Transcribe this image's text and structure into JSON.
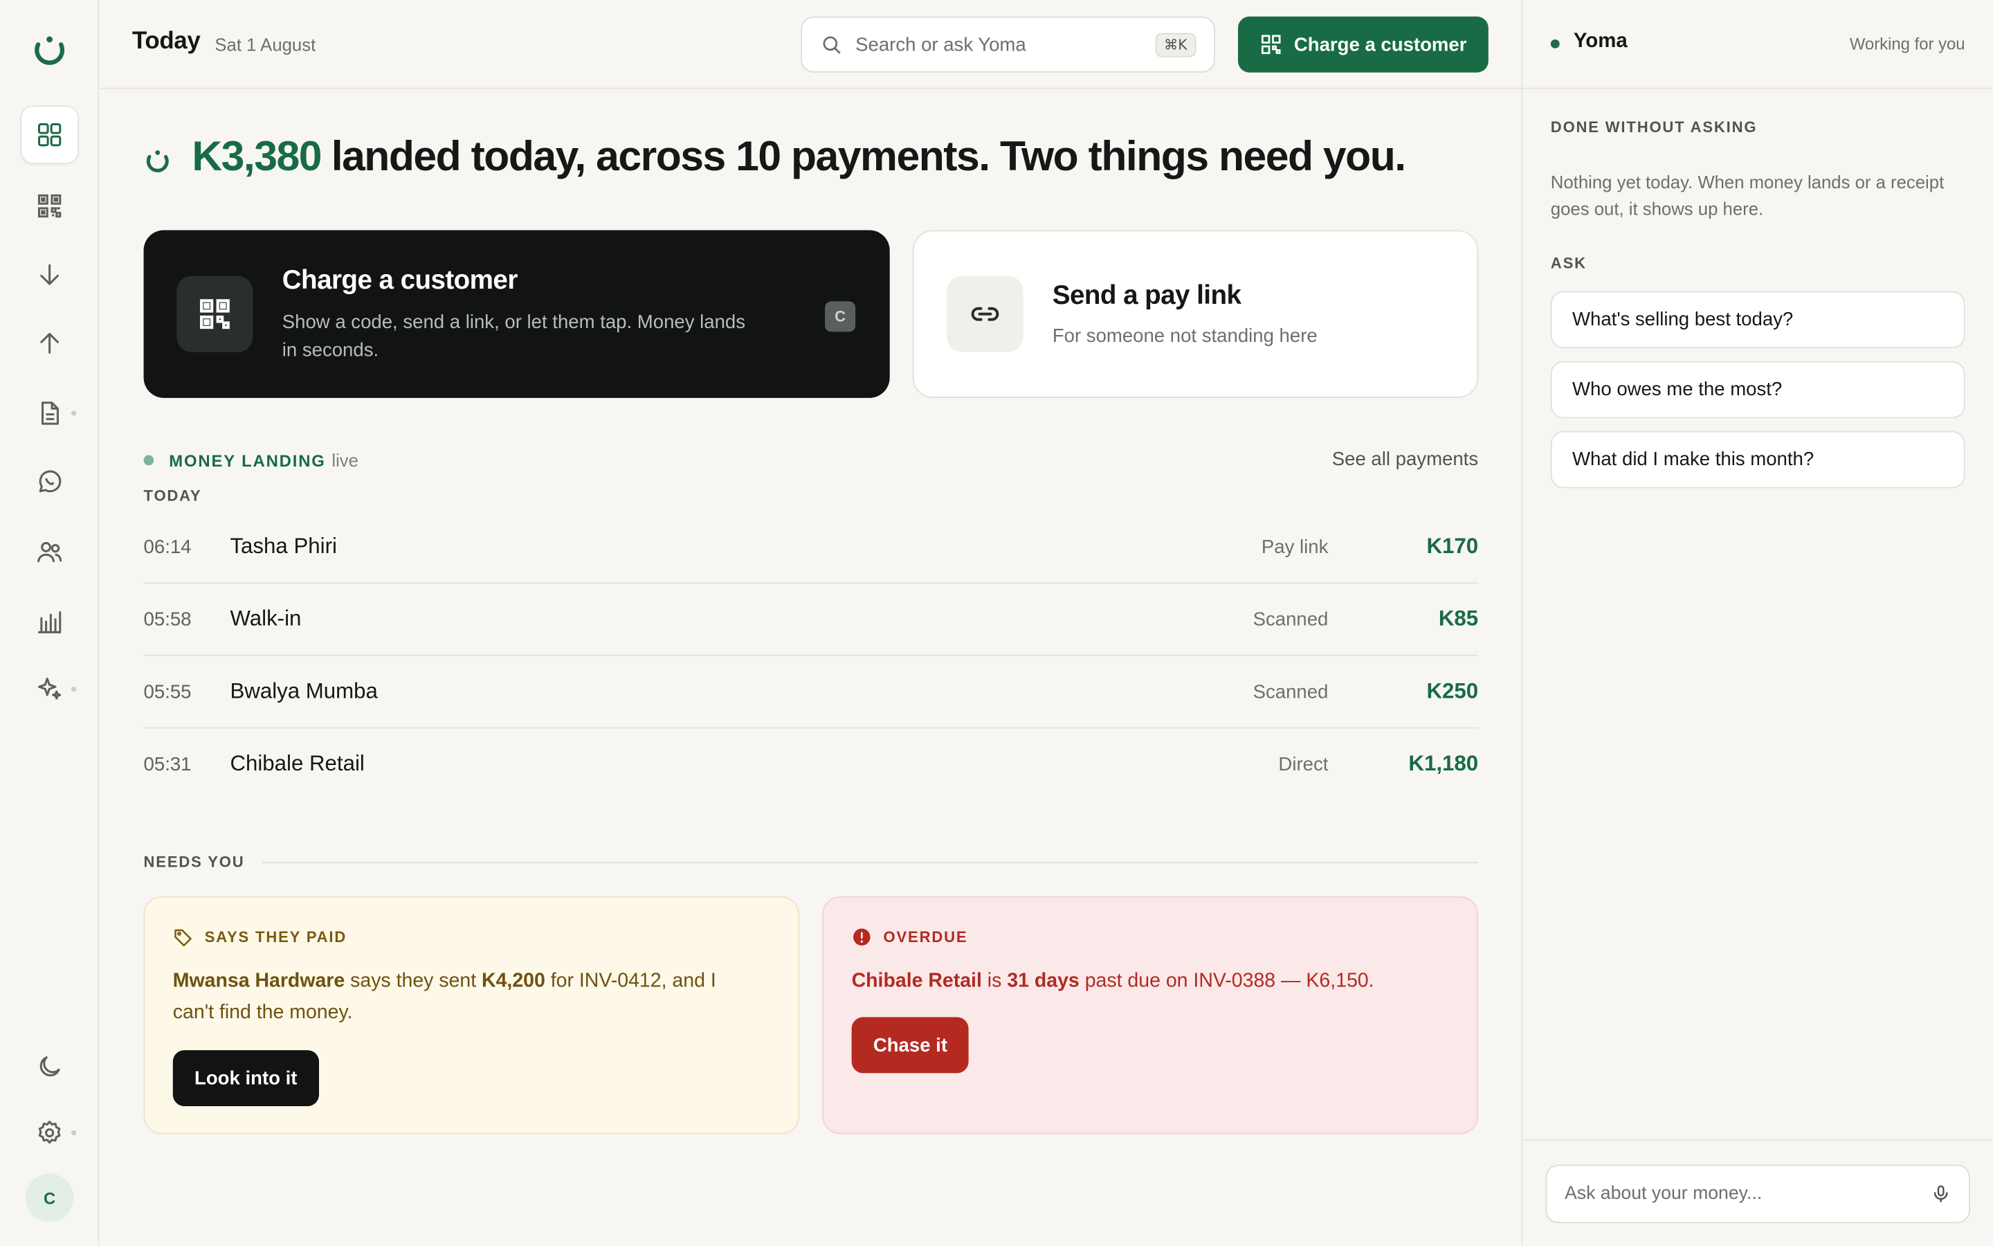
{
  "topbar": {
    "title": "Today",
    "date": "Sat 1 August",
    "search_placeholder": "Search or ask Yoma",
    "search_shortcut": "⌘K",
    "charge_button": "Charge a customer"
  },
  "headline": {
    "amount": "K3,380",
    "text": "landed today, across 10 payments. Two things need you."
  },
  "quick_actions": {
    "charge": {
      "title": "Charge a customer",
      "description": "Show a code, send a link, or let them tap. Money lands in seconds.",
      "shortcut": "C"
    },
    "pay_link": {
      "title": "Send a pay link",
      "description": "For someone not standing here"
    }
  },
  "money_landing": {
    "label": "MONEY LANDING",
    "status": "live",
    "see_all": "See all payments",
    "group_label": "TODAY",
    "payments": [
      {
        "time": "06:14",
        "name": "Tasha Phiri",
        "method": "Pay link",
        "amount": "K170"
      },
      {
        "time": "05:58",
        "name": "Walk-in",
        "method": "Scanned",
        "amount": "K85"
      },
      {
        "time": "05:55",
        "name": "Bwalya Mumba",
        "method": "Scanned",
        "amount": "K250"
      },
      {
        "time": "05:31",
        "name": "Chibale Retail",
        "method": "Direct",
        "amount": "K1,180"
      }
    ]
  },
  "needs_you": {
    "label": "NEEDS YOU",
    "says_paid": {
      "tag": "SAYS THEY PAID",
      "customer": "Mwansa Hardware",
      "text1": "says they sent",
      "amount": "K4,200",
      "text2": "for INV-0412, and I can't find the money.",
      "button": "Look into it"
    },
    "overdue": {
      "tag": "OVERDUE",
      "customer": "Chibale Retail",
      "text1": "is",
      "days": "31 days",
      "text2": "past due on INV-0388 — K6,150.",
      "button": "Chase it"
    }
  },
  "assistant": {
    "name": "Yoma",
    "status": "Working for you",
    "done_label": "DONE WITHOUT ASKING",
    "done_text": "Nothing yet today. When money lands or a receipt goes out, it shows up here.",
    "ask_label": "ASK",
    "suggestions": [
      "What's selling best today?",
      "Who owes me the most?",
      "What did I make this month?"
    ],
    "input_placeholder": "Ask about your money..."
  },
  "user": {
    "initial": "C"
  },
  "colors": {
    "brand": "#186b44",
    "dark_card": "#111412",
    "alert_yellow_bg": "#fdf8e8",
    "alert_red_bg": "#fbe8e8",
    "alert_red": "#b42a21"
  }
}
